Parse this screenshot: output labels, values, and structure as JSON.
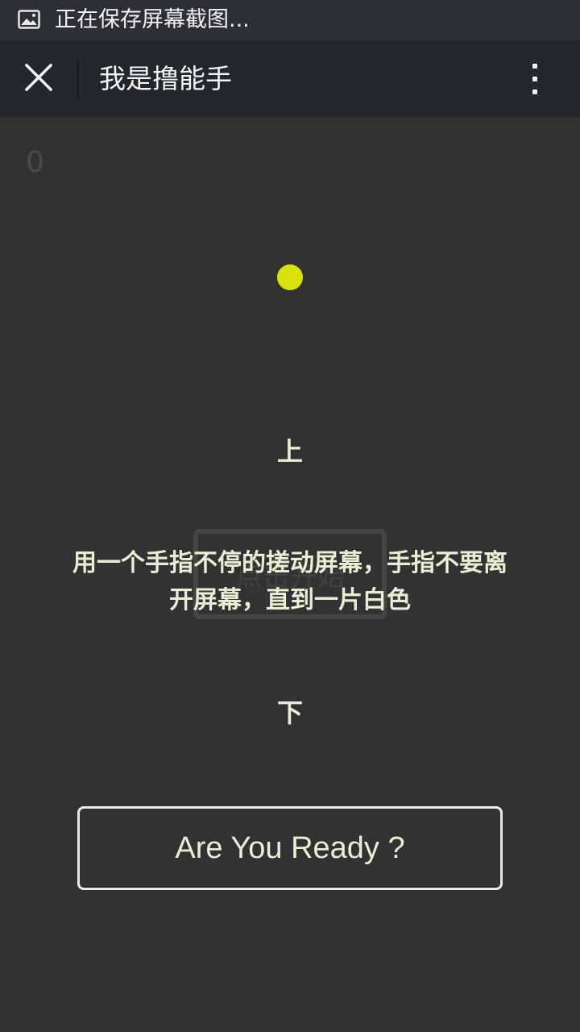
{
  "status_bar": {
    "icon": "image-icon",
    "text": "正在保存屏幕截图..."
  },
  "title_bar": {
    "close_icon": "close-icon",
    "title": "我是撸能手",
    "more_icon": "more-vertical-icon"
  },
  "game": {
    "score": "0",
    "ball_color": "#d8e20a",
    "label_up": "上",
    "label_down": "下",
    "start_button": "点击开始",
    "instruction": "用一个手指不停的搓动屏幕，手指不要离开屏幕，直到一片白色",
    "ready_button": "Are You Ready ?"
  }
}
